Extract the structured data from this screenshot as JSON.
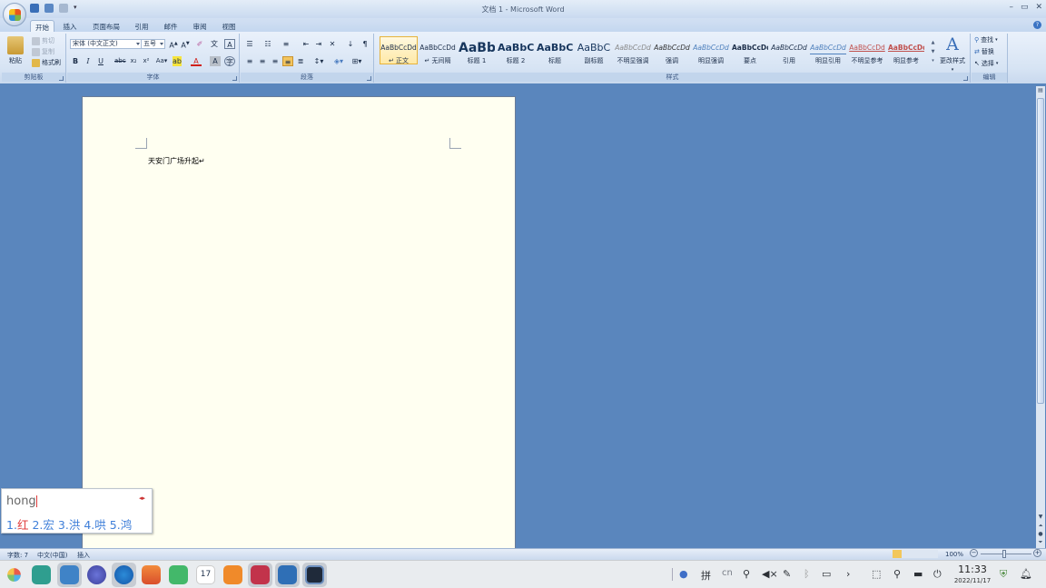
{
  "window": {
    "title": "文档 1 - Microsoft Word"
  },
  "tabs": [
    {
      "label": "开始",
      "active": true
    },
    {
      "label": "插入"
    },
    {
      "label": "页面布局"
    },
    {
      "label": "引用"
    },
    {
      "label": "邮件"
    },
    {
      "label": "审阅"
    },
    {
      "label": "视图"
    }
  ],
  "clipboard": {
    "paste": "粘贴",
    "cut": "剪切",
    "copy": "复制",
    "format_painter": "格式刷",
    "group": "剪贴板"
  },
  "font": {
    "name": "宋体 (中文正文)",
    "size": "五号",
    "group": "字体"
  },
  "paragraph": {
    "group": "段落"
  },
  "styles": {
    "group": "样式",
    "change_styles": "更改样式",
    "items": [
      {
        "preview": "AaBbCcDd",
        "name": "↵ 正文",
        "selected": true
      },
      {
        "preview": "AaBbCcDd",
        "name": "↵ 无间隔"
      },
      {
        "preview": "AaBb",
        "name": "标题 1"
      },
      {
        "preview": "AaBbC",
        "name": "标题 2"
      },
      {
        "preview": "AaBbC",
        "name": "标题"
      },
      {
        "preview": "AaBbC",
        "name": "副标题"
      },
      {
        "preview": "AaBbCcDd",
        "name": "不明显强调"
      },
      {
        "preview": "AaBbCcDd",
        "name": "强调"
      },
      {
        "preview": "AaBbCcDd",
        "name": "明显强调"
      },
      {
        "preview": "AaBbCcDd",
        "name": "要点"
      },
      {
        "preview": "AaBbCcDd",
        "name": "引用"
      },
      {
        "preview": "AaBbCcDd",
        "name": "明显引用"
      },
      {
        "preview": "AaBbCcDd",
        "name": "不明显参考"
      },
      {
        "preview": "AaBbCcDd",
        "name": "明显参考"
      }
    ]
  },
  "editing": {
    "find": "查找",
    "replace": "替换",
    "select": "选择",
    "group": "编辑"
  },
  "document": {
    "text": "天安门广场升起↵"
  },
  "ime": {
    "input": "hong",
    "candidates": [
      {
        "num": "1.",
        "char": "红"
      },
      {
        "num": "2.",
        "char": "宏"
      },
      {
        "num": "3.",
        "char": "洪"
      },
      {
        "num": "4.",
        "char": "哄"
      },
      {
        "num": "5.",
        "char": "鸿"
      }
    ]
  },
  "status": {
    "word_count": "字数: 7",
    "language": "中文(中国)",
    "mode": "插入",
    "zoom": "100%"
  },
  "taskbar": {
    "ime_label": "拼",
    "lang": "cn",
    "time": "11:33",
    "date": "2022/11/17",
    "calendar_day": "17"
  },
  "colors": {
    "accent": "#2b579a",
    "ime_candidate": "#3f7fd9",
    "ime_selected": "#e03c3c",
    "page_bg": "#fffff1",
    "workspace": "#5a86bd"
  }
}
